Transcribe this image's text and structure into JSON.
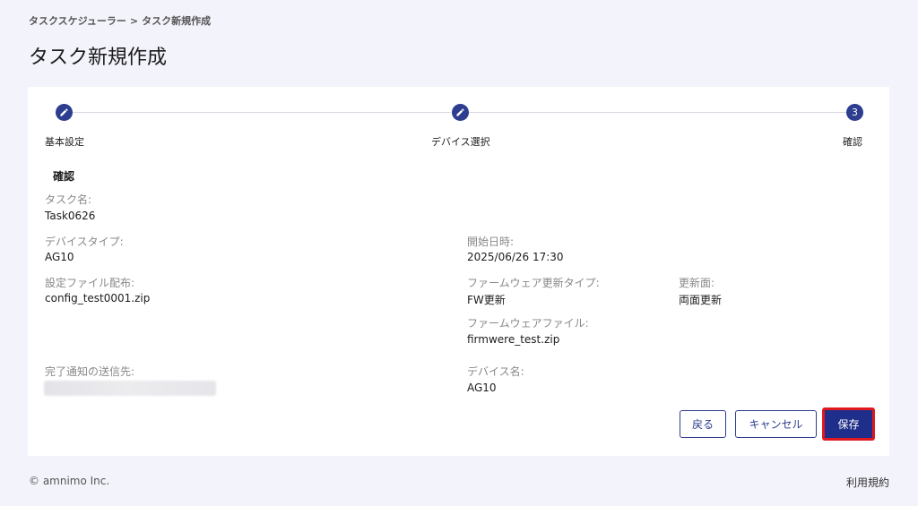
{
  "breadcrumb": {
    "parent": "タスクスケジューラー",
    "separator": ">",
    "current": "タスク新規作成"
  },
  "page": {
    "title": "タスク新規作成"
  },
  "stepper": {
    "steps": [
      {
        "label": "基本設定",
        "state": "done",
        "icon": "pencil-icon"
      },
      {
        "label": "デバイス選択",
        "state": "done",
        "icon": "pencil-icon"
      },
      {
        "label": "確認",
        "state": "current",
        "number": "3"
      }
    ]
  },
  "confirm": {
    "section_title": "確認",
    "task_name_label": "タスク名:",
    "task_name_value": "Task0626",
    "device_type_label": "デバイスタイプ:",
    "device_type_value": "AG10",
    "start_datetime_label": "開始日時:",
    "start_datetime_value": "2025/06/26 17:30",
    "config_file_label": "設定ファイル配布:",
    "config_file_value": "config_test0001.zip",
    "fw_update_type_label": "ファームウェア更新タイプ:",
    "fw_update_type_value": "FW更新",
    "update_side_label": "更新面:",
    "update_side_value": "両面更新",
    "fw_file_label": "ファームウェアファイル:",
    "fw_file_value": "firmwere_test.zip",
    "notify_label": "完了通知の送信先:",
    "device_name_label": "デバイス名:",
    "device_name_value": "AG10"
  },
  "buttons": {
    "back": "戻る",
    "cancel": "キャンセル",
    "save": "保存"
  },
  "footer": {
    "copyright": "© amnimo Inc.",
    "terms": "利用規約"
  },
  "colors": {
    "primary": "#2d3d8f",
    "save_bg": "#1f2e8a",
    "highlight": "#e0191e",
    "page_bg": "#f3f3fb"
  }
}
